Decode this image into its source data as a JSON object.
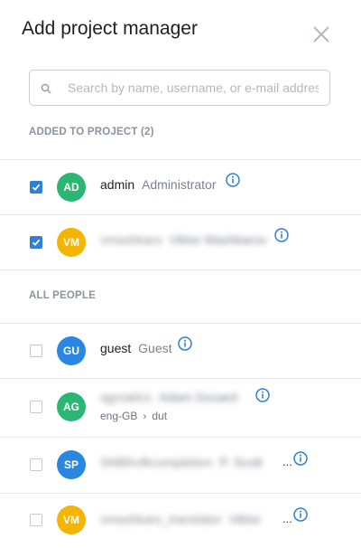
{
  "dialog": {
    "title": "Add project manager"
  },
  "search": {
    "placeholder": "Search by name, username, or e-mail address"
  },
  "added_section": {
    "label": "ADDED TO PROJECT (2)"
  },
  "all_section": {
    "label": "ALL PEOPLE"
  },
  "rows": [
    {
      "initials": "AD",
      "avatar_color": "#2bb673",
      "checked": true,
      "name": "admin",
      "role": "Administrator"
    },
    {
      "initials": "VM",
      "avatar_color": "#f5b400",
      "checked": true,
      "name": "vmashkaro",
      "role": "Viktor Mashkarov"
    },
    {
      "initials": "GU",
      "avatar_color": "#2a86e0",
      "checked": false,
      "name": "guest",
      "role": "Guest"
    },
    {
      "initials": "AG",
      "avatar_color": "#2bb673",
      "checked": false,
      "name": "agroatics",
      "role": "Adam Gouard",
      "languages": {
        "from": "eng-GB",
        "to": "dut"
      }
    },
    {
      "initials": "SP",
      "avatar_color": "#2a86e0",
      "checked": false,
      "name": "SMBlrofkcompletion",
      "role": "P. Scott",
      "ellipsis": "..."
    },
    {
      "initials": "VM",
      "avatar_color": "#f5b400",
      "checked": false,
      "name": "vmashkaro_translator",
      "role": "Viktor",
      "ellipsis": "..."
    }
  ],
  "icons": {
    "close": "close-icon",
    "search": "search-icon",
    "info": "info-icon",
    "check": "checkmark-icon"
  },
  "colors": {
    "accent": "#2f80d8",
    "section_text": "#8a93a1",
    "divider": "#e6e8ec"
  }
}
